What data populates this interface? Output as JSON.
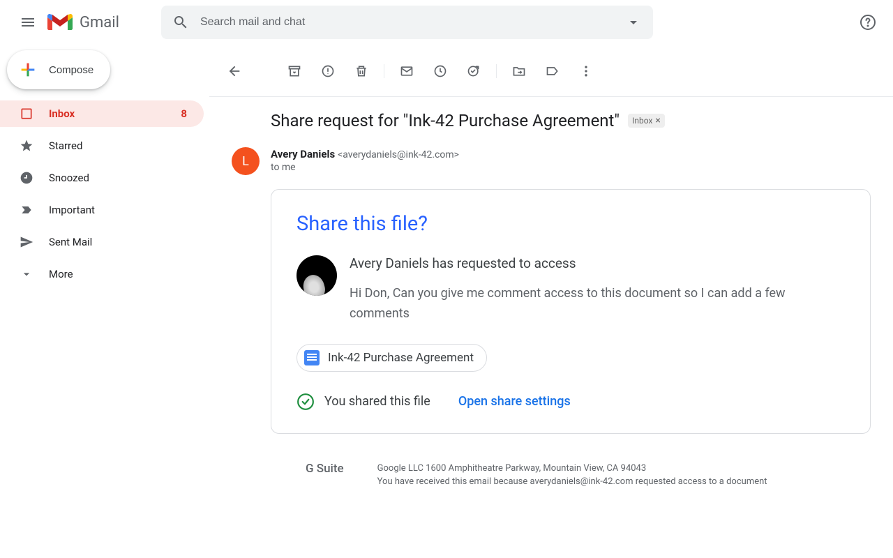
{
  "header": {
    "logo_text": "Gmail",
    "search_placeholder": "Search mail and chat"
  },
  "sidebar": {
    "compose_label": "Compose",
    "items": [
      {
        "label": "Inbox",
        "count": "8"
      },
      {
        "label": "Starred"
      },
      {
        "label": "Snoozed"
      },
      {
        "label": "Important"
      },
      {
        "label": "Sent Mail"
      },
      {
        "label": "More"
      }
    ]
  },
  "email": {
    "subject": "Share request for \"Ink-42 Purchase Agreement\"",
    "label_chip": "Inbox",
    "sender_name": "Avery Daniels",
    "sender_email": "<averydaniels@ink-42.com>",
    "recipient": "to me",
    "avatar_letter": "L"
  },
  "share_card": {
    "title": "Share this file?",
    "request_line": "Avery Daniels has requested to access",
    "message": "Hi Don, Can you give me comment access to this document so I can add a few comments",
    "doc_name": "Ink-42 Purchase Agreement",
    "status_text": "You shared this file",
    "settings_link": "Open share settings"
  },
  "footer": {
    "gsuite": "G Suite",
    "address": "Google LLC 1600 Amphitheatre Parkway, Mountain View, CA 94043",
    "reason": "You have received this email because averydaniels@ink-42.com requested access to a document"
  }
}
